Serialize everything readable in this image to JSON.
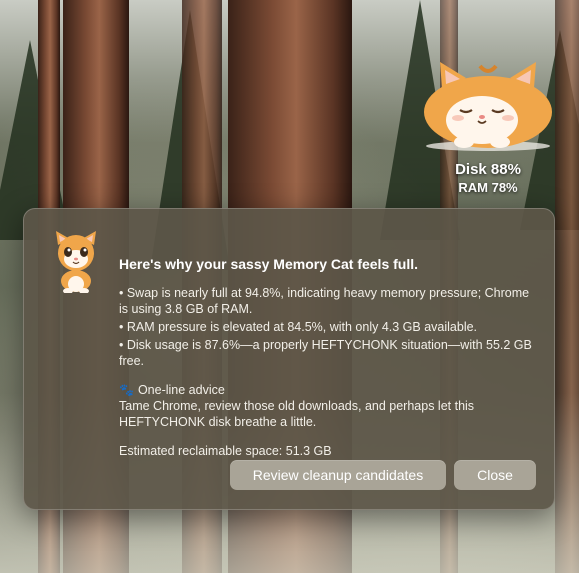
{
  "widget": {
    "disk_label": "Disk 88%",
    "ram_label": "RAM 78%",
    "icon": "sleeping-fat-cat-icon"
  },
  "dialog": {
    "icon": "kitten-icon",
    "title": "Here's why your sassy Memory Cat feels full.",
    "bullets": [
      "• Swap is nearly full at 94.8%, indicating heavy memory pressure; Chrome is using 3.8 GB of RAM.",
      "• RAM pressure is elevated at 84.5%, with only 4.3 GB available.",
      "• Disk usage is 87.6%—a properly HEFTYCHONK situation—with 55.2 GB free."
    ],
    "advice_icon": "paw-icon",
    "advice_heading": "One-line advice",
    "advice_text": "Tame Chrome, review those old downloads, and perhaps let this HEFTYCHONK disk breathe a little.",
    "estimate": "Estimated reclaimable space: 51.3 GB",
    "buttons": {
      "review": "Review cleanup candidates",
      "close": "Close"
    }
  },
  "colors": {
    "dialog_bg": "#5c5648",
    "button_bg": "#a9a497",
    "cat_orange": "#f0a64a"
  }
}
